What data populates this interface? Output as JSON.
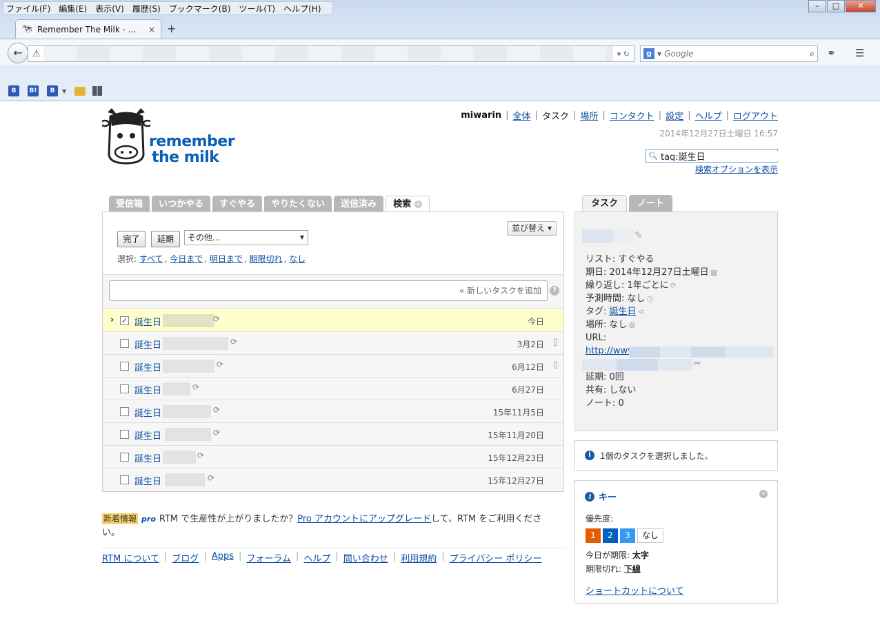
{
  "browser": {
    "menu": [
      "ファイル(F)",
      "編集(E)",
      "表示(V)",
      "履歴(S)",
      "ブックマーク(B)",
      "ツール(T)",
      "ヘルプ(H)"
    ],
    "tab_title": "Remember The Milk - ...",
    "tab_close": "×",
    "new_tab": "+",
    "search_placeholder": "Google",
    "window_buttons": [
      "–",
      "□",
      "✕"
    ]
  },
  "header": {
    "logo_line1": "remember",
    "logo_line2": "the milk",
    "username": "miwarin",
    "nav": [
      "全体",
      "タスク",
      "場所",
      "コンタクト",
      "設定",
      "ヘルプ",
      "ログアウト"
    ],
    "datetime": "2014年12月27日土曜日 16:57",
    "search_value": "tag:誕生日",
    "search_options": "検索オプションを表示"
  },
  "list_tabs": [
    "受信箱",
    "いつかやる",
    "すぐやる",
    "やりたくない",
    "送信済み",
    "検索"
  ],
  "toolbar": {
    "complete": "完了",
    "postpone": "延期",
    "more": "その他...",
    "sort": "並び替え ▾",
    "select_label": "選択:",
    "select_links": [
      "すべて",
      "今日まで",
      "明日まで",
      "期限切れ",
      "なし"
    ],
    "add_task": "« 新しいタスクを追加",
    "help": "?"
  },
  "tasks": [
    {
      "tag": "誕生日",
      "due": "今日",
      "checked": true,
      "selected": true,
      "note": false
    },
    {
      "tag": "誕生日",
      "due": "3月2日",
      "checked": false,
      "selected": false,
      "note": true
    },
    {
      "tag": "誕生日",
      "due": "6月12日",
      "checked": false,
      "selected": false,
      "note": true
    },
    {
      "tag": "誕生日",
      "due": "6月27日",
      "checked": false,
      "selected": false,
      "note": false
    },
    {
      "tag": "誕生日",
      "due": "15年11月5日",
      "checked": false,
      "selected": false,
      "note": false
    },
    {
      "tag": "誕生日",
      "due": "15年11月20日",
      "checked": false,
      "selected": false,
      "note": false
    },
    {
      "tag": "誕生日",
      "due": "15年12月23日",
      "checked": false,
      "selected": false,
      "note": false
    },
    {
      "tag": "誕生日",
      "due": "15年12月27日",
      "checked": false,
      "selected": false,
      "note": false
    }
  ],
  "news": {
    "badge": "新着情報",
    "pro": "pro",
    "text_before": "RTM で生産性が上がりましたか？",
    "link": "Pro アカウントにアップグレード",
    "text_after": "して、RTM をご利用ください。"
  },
  "footer": [
    "RTM について",
    "ブログ",
    "Apps",
    "フォーラム",
    "ヘルプ",
    "問い合わせ",
    "利用規約",
    "プライバシー ポリシー"
  ],
  "detail_tabs": [
    "タスク",
    "ノート"
  ],
  "detail": {
    "list": "リスト: すぐやる",
    "due": "期日: 2014年12月27日土曜日",
    "repeat": "繰り返し: 1年ごとに",
    "estimate": "予測時間: なし",
    "tags_label": "タグ: ",
    "tags_value": "誕生日",
    "location": "場所: なし",
    "url_label": "URL: ",
    "url_value": "http://www.amazon.co.jp/registry/wishlist/",
    "postponed": "延期: 0回",
    "shared": "共有: しない",
    "notes": "ノート: 0"
  },
  "info": {
    "text": "1個のタスクを選択しました。"
  },
  "keys": {
    "title": "キー",
    "priority_label": "優先度:",
    "priorities": [
      "1",
      "2",
      "3",
      "なし"
    ],
    "due_today_label": "今日が期限: ",
    "due_today_value": "太字",
    "overdue_label": "期限切れ: ",
    "overdue_value": "下線",
    "shortcut_link": "ショートカットについて"
  }
}
